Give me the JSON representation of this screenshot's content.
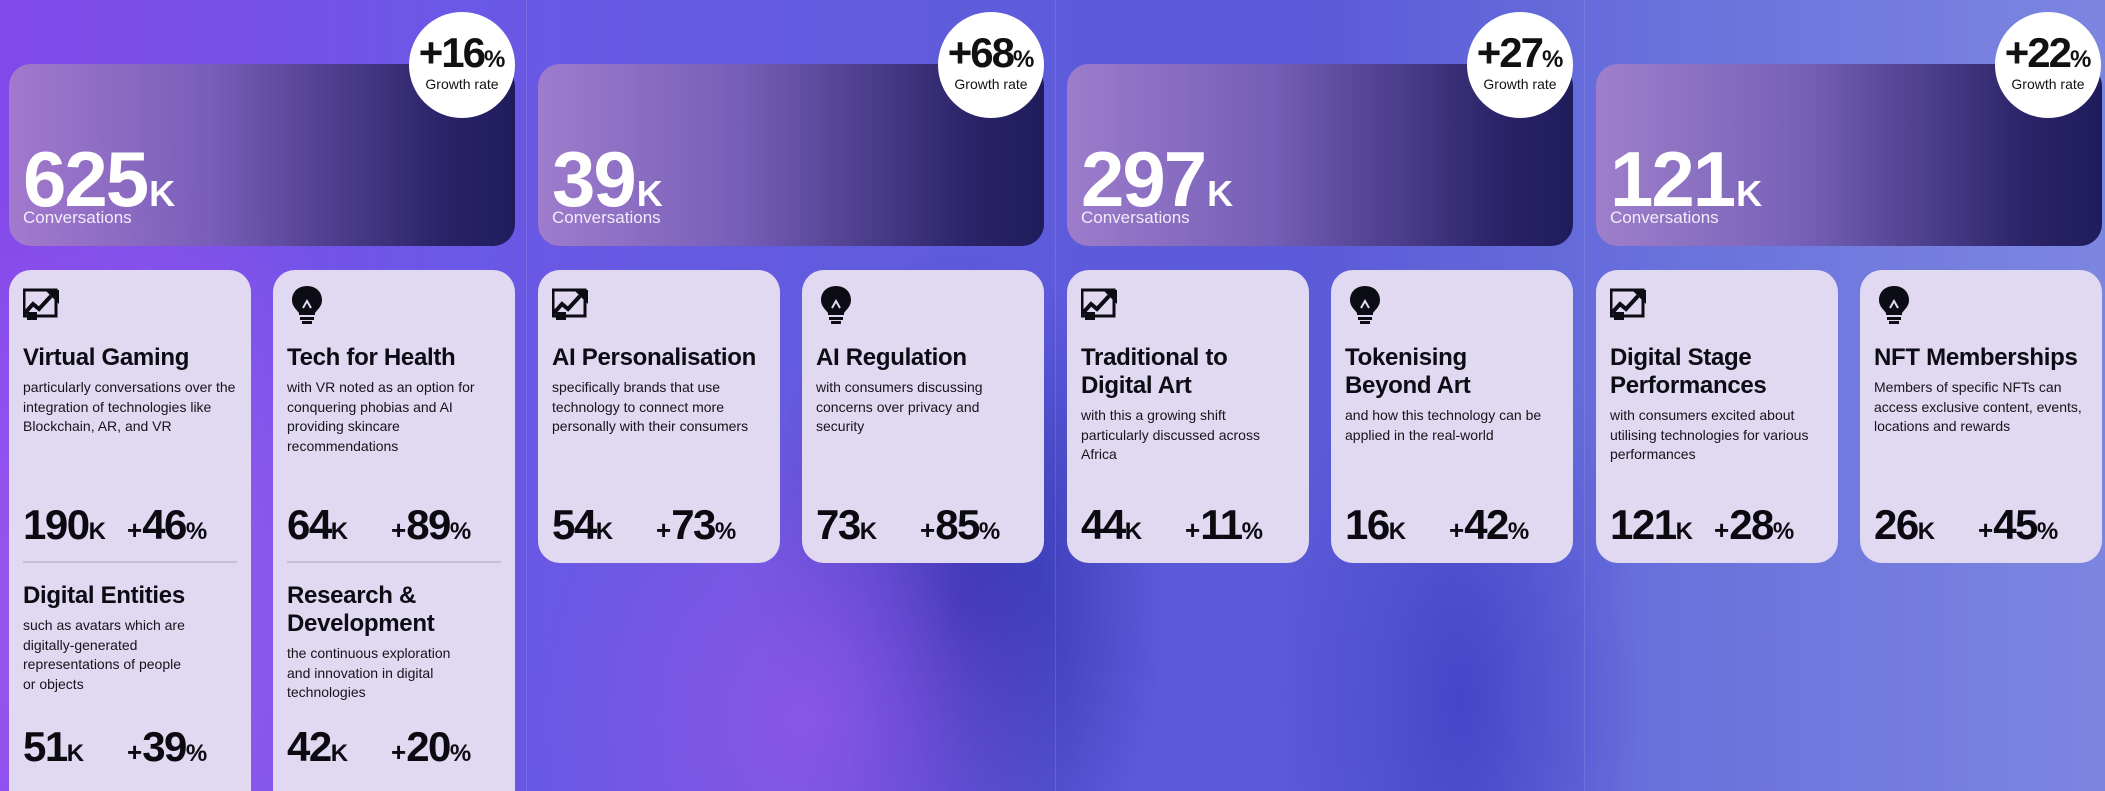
{
  "columns": [
    {
      "conversations_value": "625",
      "conversations_unit": "K",
      "conversations_label": "Conversations",
      "growth_value": "+16",
      "growth_unit": "%",
      "growth_label": "Growth rate",
      "cards": [
        {
          "icon": "trending-chart-icon",
          "topics": [
            {
              "title": "Virtual Gaming",
              "desc": "particularly conversations over the integration of technologies like Blockchain, AR, and VR",
              "count": "190",
              "count_unit": "K",
              "growth_sign": "+",
              "growth": "46",
              "growth_unit": "%"
            },
            {
              "title": "Digital Entities",
              "desc": "such as avatars which are digitally-generated representations of people or objects",
              "count": "51",
              "count_unit": "K",
              "growth_sign": "+",
              "growth": "39",
              "growth_unit": "%"
            }
          ]
        },
        {
          "icon": "lightbulb-icon",
          "topics": [
            {
              "title": "Tech for Health",
              "desc": "with VR noted as an option for conquering phobias and AI providing skincare recommendations",
              "count": "64",
              "count_unit": "K",
              "growth_sign": "+",
              "growth": "89",
              "growth_unit": "%"
            },
            {
              "title": "Research & Development",
              "desc": "the continuous exploration and innovation in digital technologies",
              "count": "42",
              "count_unit": "K",
              "growth_sign": "+",
              "growth": "20",
              "growth_unit": "%"
            }
          ]
        }
      ]
    },
    {
      "conversations_value": "39",
      "conversations_unit": "K",
      "conversations_label": "Conversations",
      "growth_value": "+68",
      "growth_unit": "%",
      "growth_label": "Growth rate",
      "cards": [
        {
          "icon": "trending-chart-icon",
          "topics": [
            {
              "title": "AI Personalisation",
              "desc": "specifically brands that use technology to connect more personally with their consumers",
              "count": "54",
              "count_unit": "K",
              "growth_sign": "+",
              "growth": "73",
              "growth_unit": "%"
            }
          ]
        },
        {
          "icon": "lightbulb-icon",
          "topics": [
            {
              "title": "AI Regulation",
              "desc": "with consumers discussing concerns over privacy and security",
              "count": "73",
              "count_unit": "K",
              "growth_sign": "+",
              "growth": "85",
              "growth_unit": "%"
            }
          ]
        }
      ]
    },
    {
      "conversations_value": "297",
      "conversations_unit": "K",
      "conversations_label": "Conversations",
      "growth_value": "+27",
      "growth_unit": "%",
      "growth_label": "Growth rate",
      "cards": [
        {
          "icon": "trending-chart-icon",
          "topics": [
            {
              "title": "Traditional to Digital Art",
              "desc": "with this a growing shift particularly discussed across Africa",
              "count": "44",
              "count_unit": "K",
              "growth_sign": "+",
              "growth": "11",
              "growth_unit": "%"
            }
          ]
        },
        {
          "icon": "lightbulb-icon",
          "topics": [
            {
              "title": "Tokenising Beyond Art",
              "desc": "and how this technology can be applied in the real-world",
              "count": "16",
              "count_unit": "K",
              "growth_sign": "+",
              "growth": "42",
              "growth_unit": "%"
            }
          ]
        }
      ]
    },
    {
      "conversations_value": "121",
      "conversations_unit": "K",
      "conversations_label": "Conversations",
      "growth_value": "+22",
      "growth_unit": "%",
      "growth_label": "Growth rate",
      "cards": [
        {
          "icon": "trending-chart-icon",
          "topics": [
            {
              "title": "Digital Stage Performances",
              "desc": "with consumers excited about utilising technologies for various performances",
              "count": "121",
              "count_unit": "K",
              "growth_sign": "+",
              "growth": "28",
              "growth_unit": "%"
            }
          ]
        },
        {
          "icon": "lightbulb-icon",
          "topics": [
            {
              "title": "NFT Memberships",
              "desc": "Members of specific NFTs can access exclusive content, events, locations and rewards",
              "count": "26",
              "count_unit": "K",
              "growth_sign": "+",
              "growth": "45",
              "growth_unit": "%"
            }
          ]
        }
      ]
    }
  ]
}
